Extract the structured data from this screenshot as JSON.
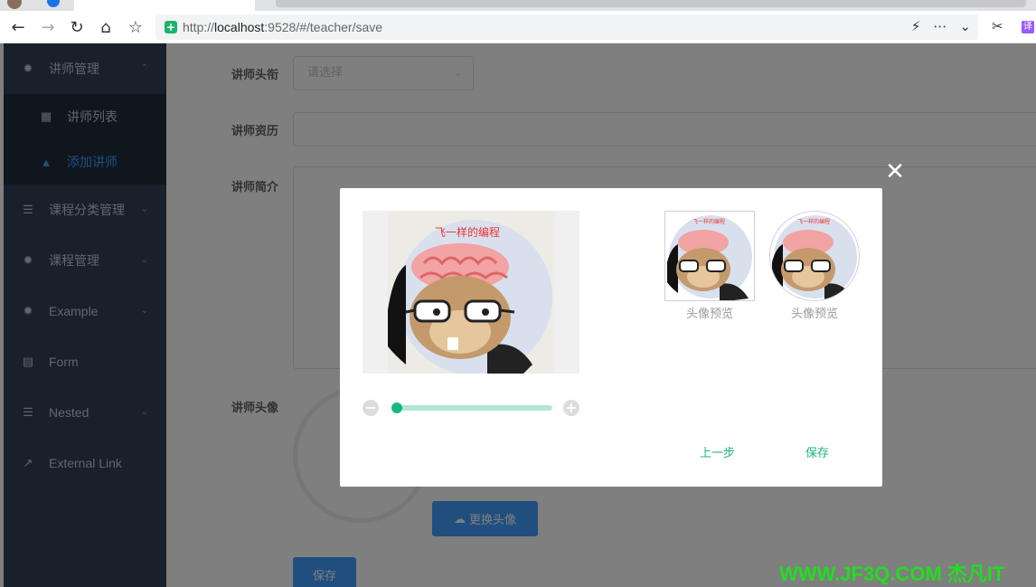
{
  "browser": {
    "url_prefix": "http://",
    "url_host": "localhost",
    "url_rest": ":9528/#/teacher/save",
    "translate_label": "译"
  },
  "sidebar": {
    "items": [
      {
        "label": "讲师管理",
        "icon": "cog-icon",
        "expanded": true
      },
      {
        "label": "讲师列表",
        "icon": "table-icon",
        "sub": true
      },
      {
        "label": "添加讲师",
        "icon": "tree-icon",
        "sub": true,
        "active": true
      },
      {
        "label": "课程分类管理",
        "icon": "list-icon"
      },
      {
        "label": "课程管理",
        "icon": "cog-icon"
      },
      {
        "label": "Example",
        "icon": "cog-icon"
      },
      {
        "label": "Form",
        "icon": "form-icon"
      },
      {
        "label": "Nested",
        "icon": "list-icon"
      },
      {
        "label": "External Link",
        "icon": "external-link-icon"
      }
    ]
  },
  "form": {
    "title_label": "讲师头衔",
    "title_placeholder": "请选择",
    "career_label": "讲师资历",
    "intro_label": "讲师简介",
    "avatar_label": "讲师头像",
    "change_avatar_label": "更换头像",
    "save_label": "保存"
  },
  "dialog": {
    "photo_caption": "飞一样的编程",
    "preview_label_square": "头像预览",
    "preview_label_round": "头像预览",
    "prev_step_label": "上一步",
    "save_label": "保存",
    "zoom_level": 0.02
  },
  "watermark": "WWW.JF3Q.COM 杰凡IT",
  "colors": {
    "sidebar_bg": "#304156",
    "submenu_bg": "#1f2d3d",
    "primary": "#409eff",
    "accent_green": "#1bb583"
  }
}
